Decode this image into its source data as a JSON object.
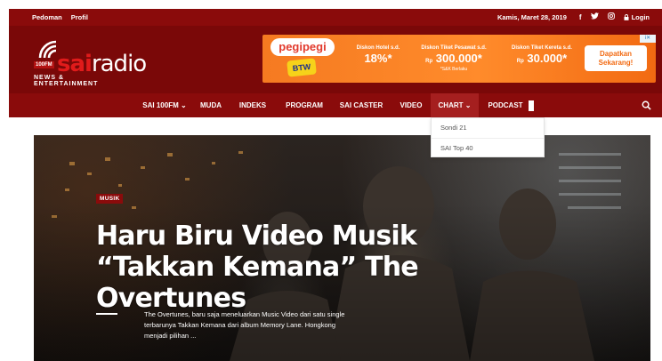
{
  "topbar": {
    "links": [
      "Pedoman",
      "Profil"
    ],
    "date": "Kamis, Maret 28, 2019",
    "login_label": "Login"
  },
  "header": {
    "logo": {
      "freq": "100FM",
      "brand_sai": "sai",
      "brand_radio": "radio",
      "tagline": "NEWS & ENTERTAINMENT"
    }
  },
  "ad": {
    "brand": "pegipegi",
    "btw": "BTW",
    "deals": [
      {
        "title": "Diskon Hotel s.d.",
        "value": "18%*",
        "note": ""
      },
      {
        "title": "Diskon Tiket Pesawat s.d.",
        "value": "300.000*",
        "currency": "Rp",
        "note": "*S&K Berlaku"
      },
      {
        "title": "Diskon Tiket Kereta s.d.",
        "value": "30.000*",
        "currency": "Rp",
        "note": ""
      }
    ],
    "cta": "Dapatkan Sekarang!"
  },
  "nav": {
    "items": [
      "SAI 100FM",
      "MUDA",
      "INDEKS",
      "PROGRAM",
      "SAI CASTER",
      "VIDEO",
      "CHART",
      "PODCAST"
    ],
    "active": "CHART"
  },
  "dropdown": {
    "items": [
      "Sondi 21",
      "SAI Top 40"
    ]
  },
  "hero": {
    "category": "MUSIK",
    "title": "Haru Biru Video Musik “Takkan Kemana” The Overtunes",
    "excerpt": "The Overtunes, baru saja meneluarkan Music Video dari satu single terbarunya Takkan Kemana dari album Memory Lane. Hongkong menjadi pilihan ..."
  },
  "colors": {
    "brand_red": "#8a0b0b",
    "header_red": "#7a0808",
    "ad_orange": "#f57a21"
  }
}
